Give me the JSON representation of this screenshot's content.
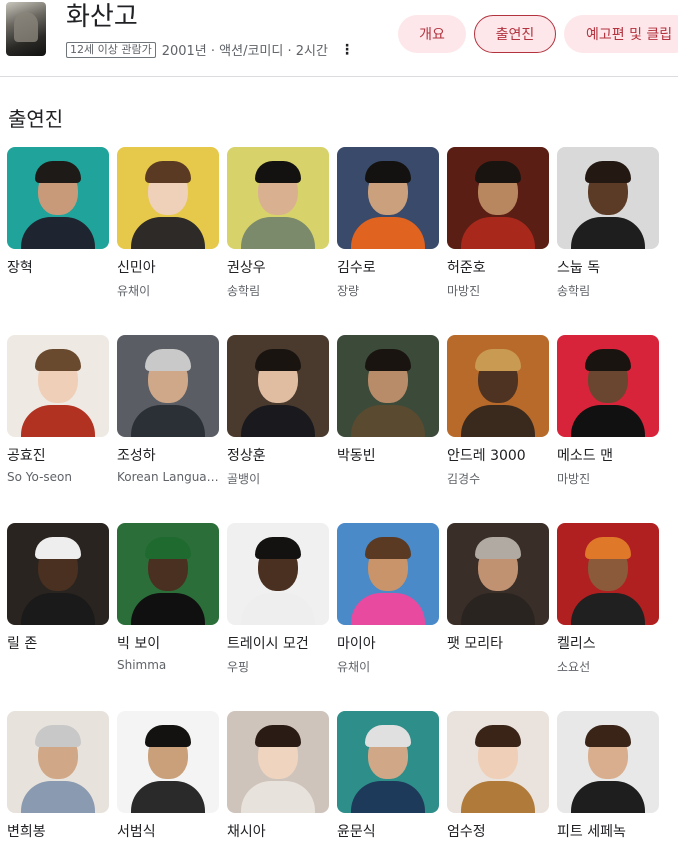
{
  "header": {
    "title": "화산고",
    "rating": "12세 이상 관람가",
    "info": "2001년 · 액션/코미디 · 2시간",
    "more_icon": "more-vert-icon",
    "tabs": [
      {
        "label": "개요",
        "active": false
      },
      {
        "label": "출연진",
        "active": true
      },
      {
        "label": "예고편 및 클립",
        "active": false
      }
    ]
  },
  "section_title": "출연진",
  "cast": [
    {
      "name": "장혁",
      "role": "",
      "bg": "#1fa39a",
      "skin": "#c99a7a",
      "hair": "#1d1a17",
      "cloth": "#1f2530"
    },
    {
      "name": "신민아",
      "role": "유채이",
      "bg": "#e6c84a",
      "skin": "#efd0b8",
      "hair": "#5a3a22",
      "cloth": "#2d2a28"
    },
    {
      "name": "권상우",
      "role": "송학림",
      "bg": "#d7d26a",
      "skin": "#d9b191",
      "hair": "#141210",
      "cloth": "#7a8a6a"
    },
    {
      "name": "김수로",
      "role": "장량",
      "bg": "#3a4a6a",
      "skin": "#caa07d",
      "hair": "#141210",
      "cloth": "#e0631f"
    },
    {
      "name": "허준호",
      "role": "마방진",
      "bg": "#5a1e14",
      "skin": "#b8875f",
      "hair": "#1a1410",
      "cloth": "#a8281c"
    },
    {
      "name": "스눕 독",
      "role": "송학림",
      "bg": "#d9d9d9",
      "skin": "#5b3b26",
      "hair": "#231812",
      "cloth": "#1e1e1e"
    },
    {
      "name": "공효진",
      "role": "So Yo-seon",
      "bg": "#eee9e2",
      "skin": "#efcfb8",
      "hair": "#6a4a2e",
      "cloth": "#b23222"
    },
    {
      "name": "조성하",
      "role": "Korean Languag...",
      "bg": "#5a5e64",
      "skin": "#cfa88a",
      "hair": "#c9c9c9",
      "cloth": "#2b2f36"
    },
    {
      "name": "정상훈",
      "role": "골뱅이",
      "bg": "#4a3a2e",
      "skin": "#e0bca0",
      "hair": "#1a1410",
      "cloth": "#1a1a1e"
    },
    {
      "name": "박동빈",
      "role": "",
      "bg": "#3c4a3a",
      "skin": "#b88c68",
      "hair": "#1a1410",
      "cloth": "#5a4a30"
    },
    {
      "name": "안드레 3000",
      "role": "김경수",
      "bg": "#b76a2a",
      "skin": "#4e3222",
      "hair": "#c99a52",
      "cloth": "#3a2a1e"
    },
    {
      "name": "메소드 맨",
      "role": "마방진",
      "bg": "#d8243a",
      "skin": "#6a4630",
      "hair": "#1a1410",
      "cloth": "#111111"
    },
    {
      "name": "릴 존",
      "role": "",
      "bg": "#2a2420",
      "skin": "#4a3020",
      "hair": "#eeeeee",
      "cloth": "#1a1a1a"
    },
    {
      "name": "빅 보이",
      "role": "Shimma",
      "bg": "#2c6e3a",
      "skin": "#4a3020",
      "hair": "#1f6a2f",
      "cloth": "#101010"
    },
    {
      "name": "트레이시 모건",
      "role": "우핑",
      "bg": "#f0f0f0",
      "skin": "#4a3020",
      "hair": "#141210",
      "cloth": "#eeeeee"
    },
    {
      "name": "마이아",
      "role": "유채이",
      "bg": "#4a8ac8",
      "skin": "#c9946a",
      "hair": "#5a3a22",
      "cloth": "#e84aa0"
    },
    {
      "name": "팻 모리타",
      "role": "",
      "bg": "#3a2e28",
      "skin": "#c09272",
      "hair": "#b0aaa2",
      "cloth": "#2a2420"
    },
    {
      "name": "켈리스",
      "role": "소요선",
      "bg": "#b02020",
      "skin": "#8a5a3a",
      "hair": "#e0782a",
      "cloth": "#202020"
    },
    {
      "name": "변희봉",
      "role": "",
      "bg": "#e8e2dc",
      "skin": "#d0a888",
      "hair": "#c8c8c8",
      "cloth": "#8a9ab0"
    },
    {
      "name": "서범식",
      "role": "",
      "bg": "#f4f4f4",
      "skin": "#caa07a",
      "hair": "#141210",
      "cloth": "#2a2a2a"
    },
    {
      "name": "채시아",
      "role": "",
      "bg": "#cfc4bc",
      "skin": "#efd4c0",
      "hair": "#2a1c14",
      "cloth": "#e8e2dc"
    },
    {
      "name": "윤문식",
      "role": "",
      "bg": "#2e8e8a",
      "skin": "#d0a888",
      "hair": "#e0e0e0",
      "cloth": "#1e3a5a"
    },
    {
      "name": "엄수정",
      "role": "",
      "bg": "#eae2dc",
      "skin": "#efcfb8",
      "hair": "#3a2418",
      "cloth": "#b07a3a"
    },
    {
      "name": "피트 세페녹",
      "role": "",
      "bg": "#e8e8e8",
      "skin": "#d8ae8e",
      "hair": "#3a2418",
      "cloth": "#1e1e1e"
    }
  ]
}
